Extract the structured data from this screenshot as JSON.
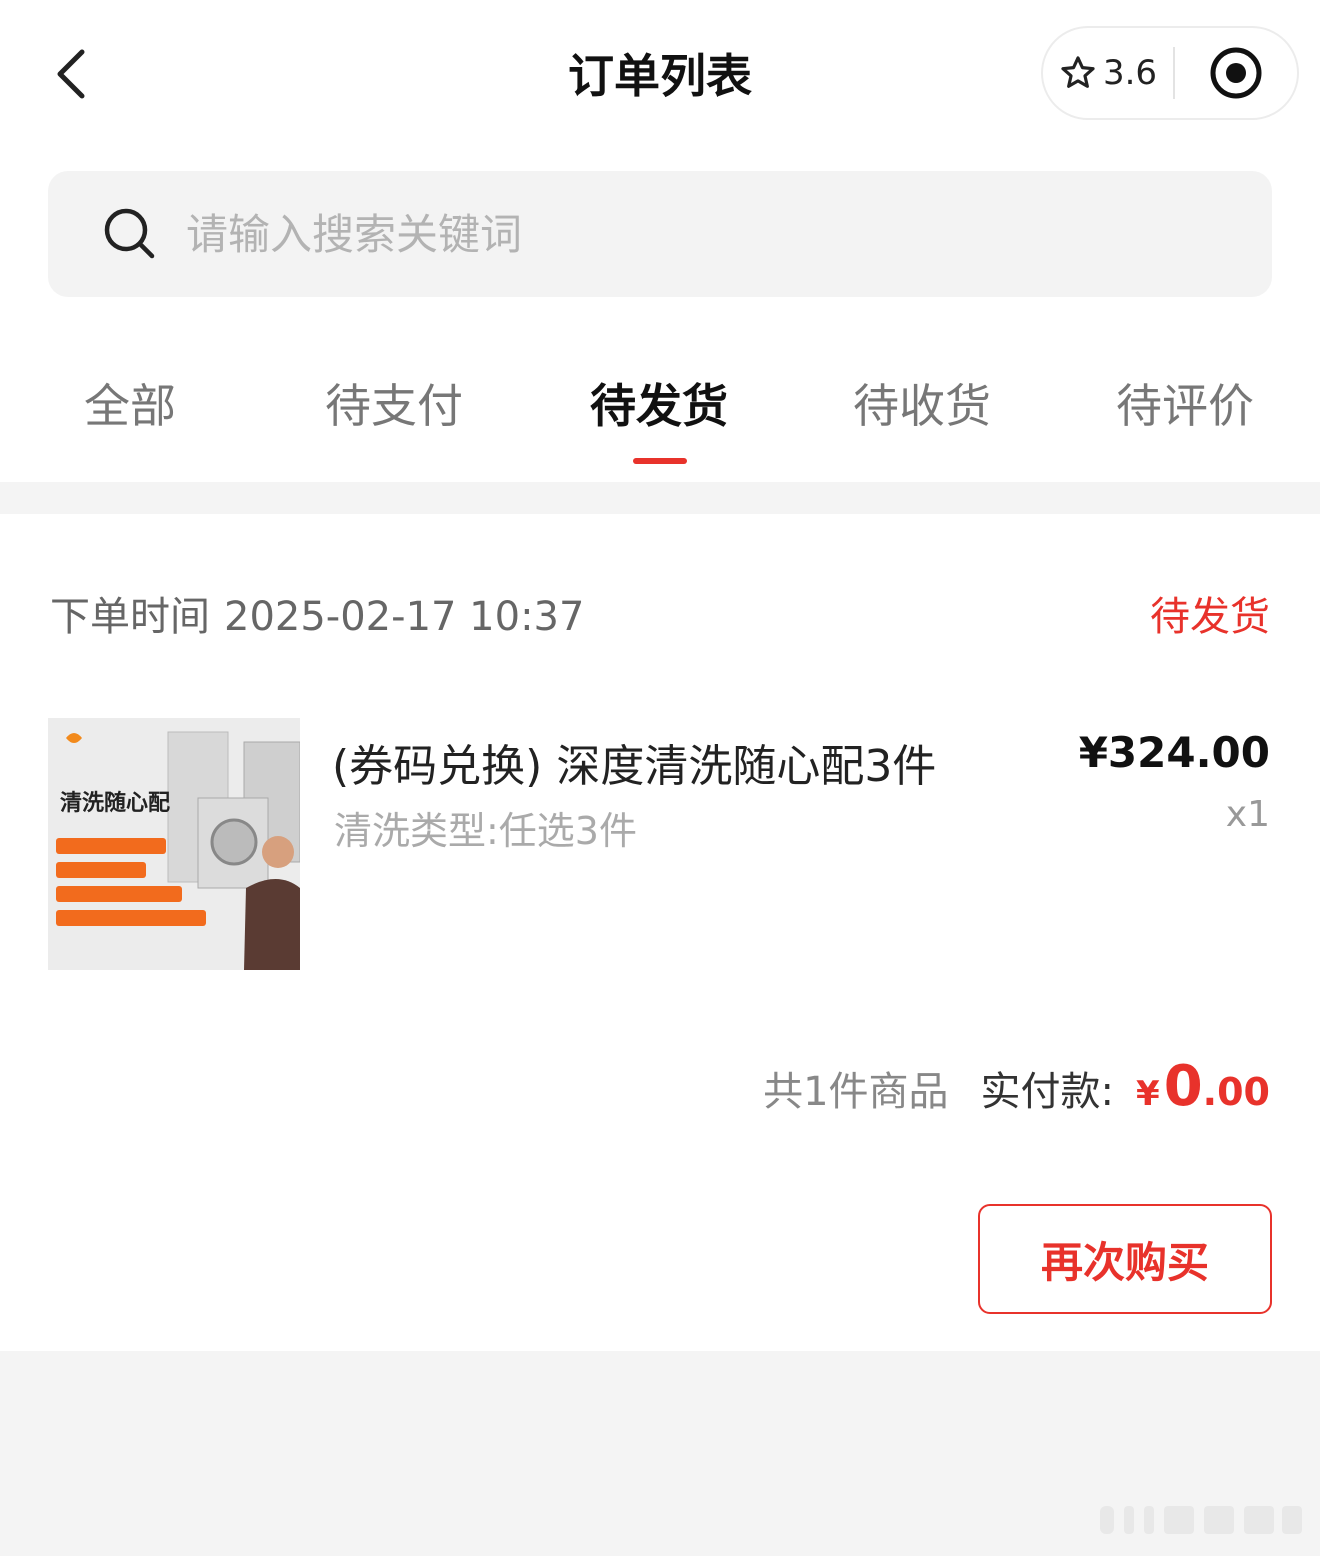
{
  "header": {
    "title": "订单列表",
    "rating": "3.6"
  },
  "search": {
    "placeholder": "请输入搜索关键词"
  },
  "tabs": [
    {
      "label": "全部"
    },
    {
      "label": "待支付"
    },
    {
      "label": "待发货"
    },
    {
      "label": "待收货"
    },
    {
      "label": "待评价"
    }
  ],
  "active_tab": "待发货",
  "order": {
    "time_label": "下单时间",
    "time_value": "2025-02-17 10:37",
    "status": "待发货",
    "product": {
      "name": "(券码兑换) 深度清洗随心配3件",
      "spec": "清洗类型:任选3件",
      "price": "¥324.00",
      "quantity": "x1",
      "thumb_title": "清洗随心配"
    },
    "summary": {
      "count_text": "共1件商品",
      "paid_label": "实付款:",
      "currency": "¥",
      "paid_int": "0",
      "paid_dec": ".00"
    },
    "action_label": "再次购买"
  },
  "colors": {
    "accent": "#e8322b",
    "background": "#f4f4f4"
  }
}
